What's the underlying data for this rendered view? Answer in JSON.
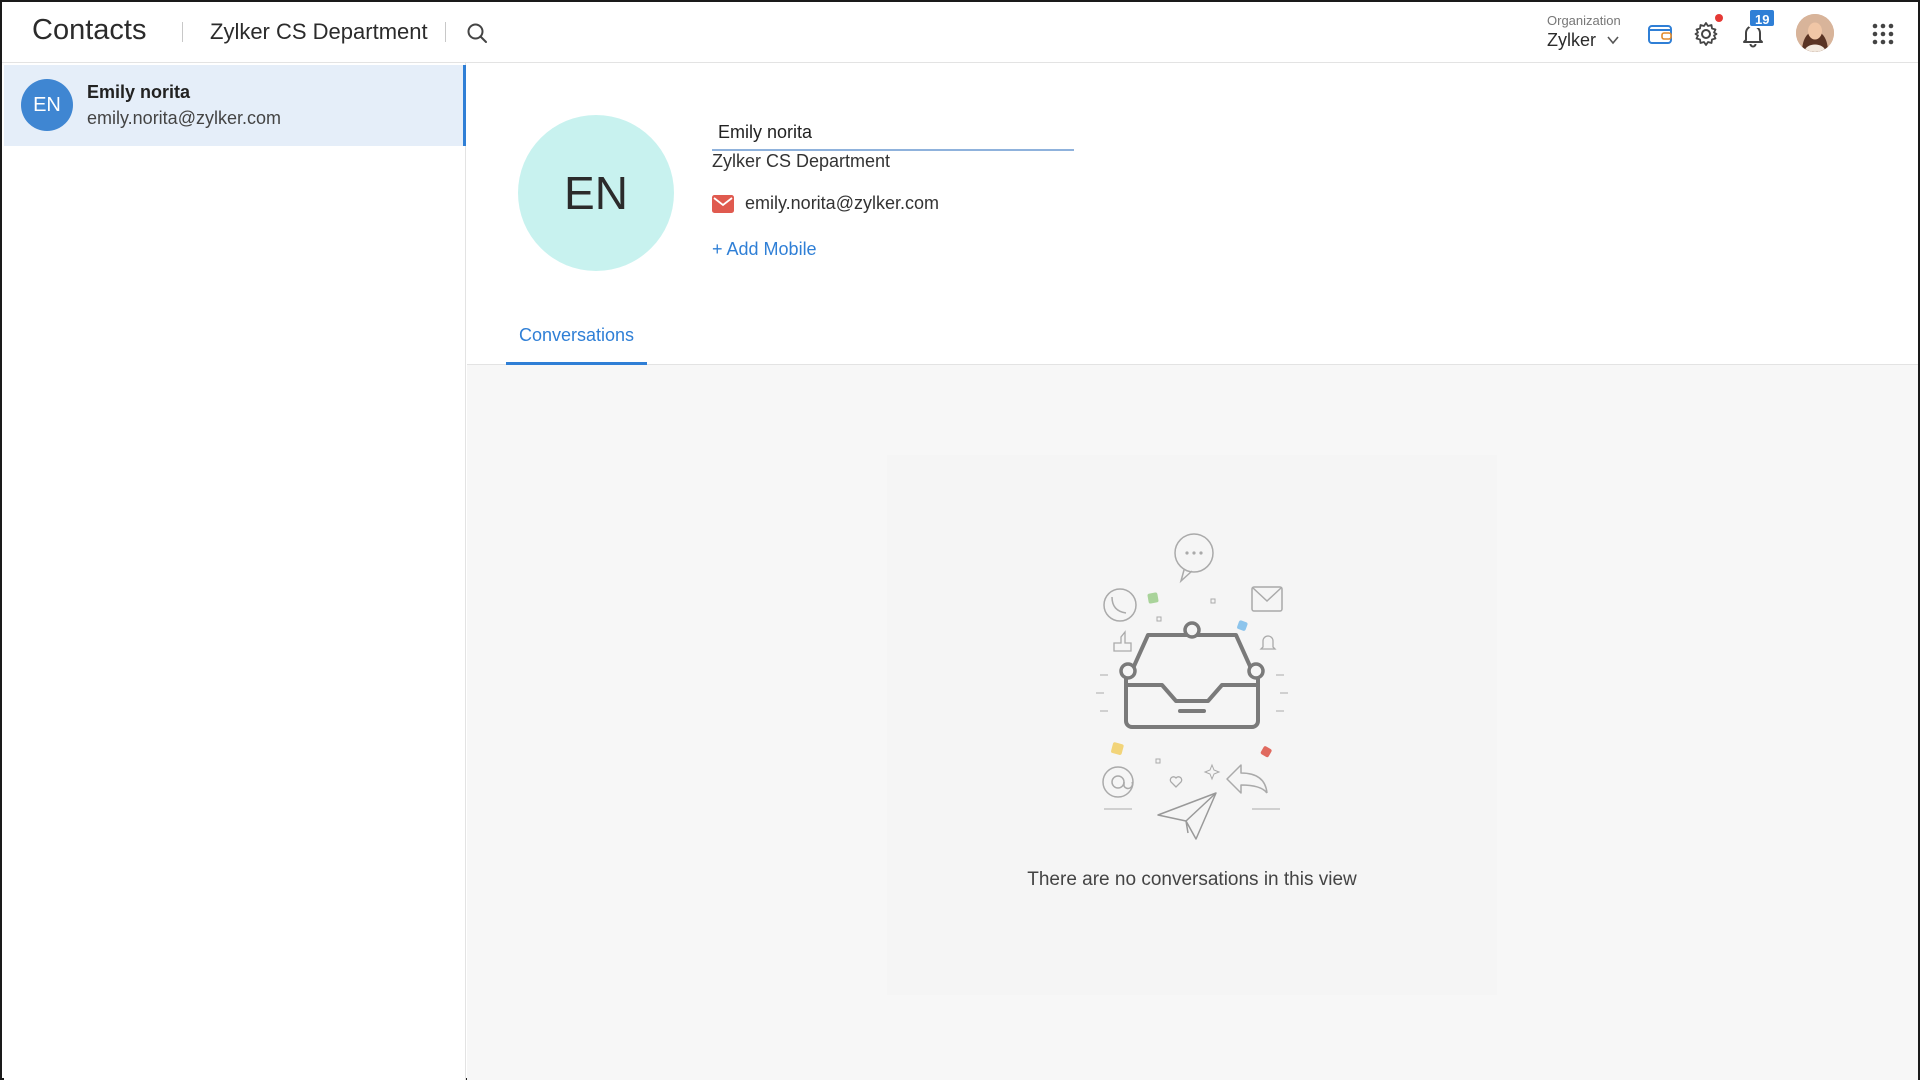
{
  "header": {
    "app_title": "Contacts",
    "department": "Zylker CS Department",
    "organization_label": "Organization",
    "organization_name": "Zylker",
    "notification_count": "19"
  },
  "contact_list": {
    "items": [
      {
        "initials": "EN",
        "name": "Emily norita",
        "email": "emily.norita@zylker.com"
      }
    ]
  },
  "contact_detail": {
    "initials": "EN",
    "name_value": "Emily norita",
    "department": "Zylker CS Department",
    "email": "emily.norita@zylker.com",
    "add_mobile_label": "+ Add Mobile"
  },
  "tabs": [
    {
      "label": "Conversations",
      "active": true
    }
  ],
  "empty_state": {
    "message": "There are no conversations in this view"
  },
  "colors": {
    "accent": "#2f7fd6",
    "selected_row": "#e5eef9",
    "avatar_large": "#c8f2ef",
    "avatar_small": "#3f86d2",
    "notification_dot": "#e53935",
    "mail_icon": "#e05a4f"
  }
}
